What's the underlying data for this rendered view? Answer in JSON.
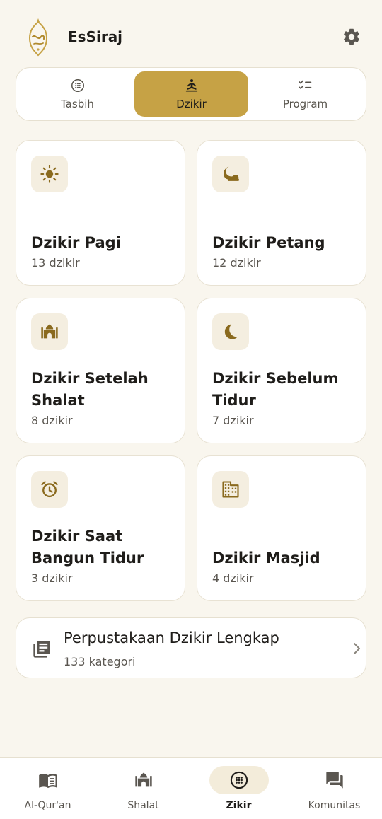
{
  "app": {
    "title": "EsSiraj",
    "accent": "#c6a245",
    "icon_brown": "#8a6a1e"
  },
  "header": {
    "logo_icon": "essiraj-lantern-logo",
    "settings_icon": "gear-icon"
  },
  "tabs": [
    {
      "label": "Tasbih",
      "icon": "tasbih-icon",
      "active": false
    },
    {
      "label": "Dzikir",
      "icon": "meditation-icon",
      "active": true
    },
    {
      "label": "Program",
      "icon": "checklist-icon",
      "active": false
    }
  ],
  "cards": [
    {
      "title": "Dzikir Pagi",
      "count": "13 dzikir",
      "icon": "sun-icon"
    },
    {
      "title": "Dzikir Petang",
      "count": "12 dzikir",
      "icon": "night-icon"
    },
    {
      "title": "Dzikir Setelah Shalat",
      "count": "8 dzikir",
      "icon": "mosque-icon"
    },
    {
      "title": "Dzikir Sebelum Tidur",
      "count": "7 dzikir",
      "icon": "moon-icon"
    },
    {
      "title": "Dzikir Saat Bangun Tidur",
      "count": "3 dzikir",
      "icon": "alarm-icon"
    },
    {
      "title": "Dzikir Masjid",
      "count": "4 dzikir",
      "icon": "building-icon"
    }
  ],
  "library": {
    "title": "Perpustakaan Dzikir Lengkap",
    "count": "133 kategori",
    "icon": "library-books-icon"
  },
  "bottom_nav": [
    {
      "label": "Al-Qur'an",
      "icon": "quran-book-icon",
      "active": false
    },
    {
      "label": "Shalat",
      "icon": "mosque-icon",
      "active": false
    },
    {
      "label": "Zikir",
      "icon": "tasbih-icon",
      "active": true
    },
    {
      "label": "Komunitas",
      "icon": "chat-forum-icon",
      "active": false
    }
  ]
}
